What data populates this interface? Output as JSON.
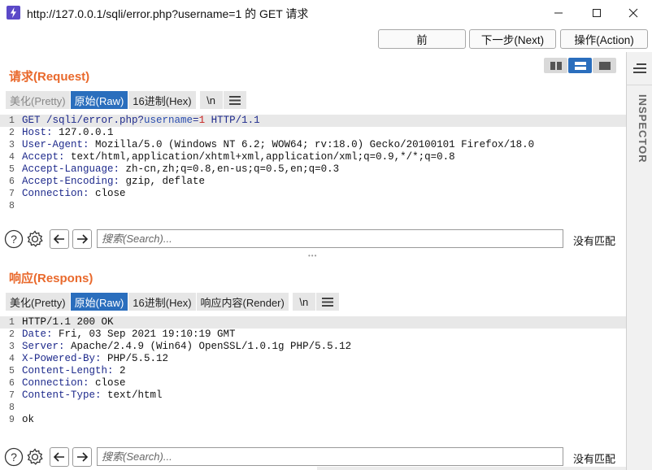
{
  "window": {
    "title": "http://127.0.0.1/sqli/error.php?username=1 的 GET 请求",
    "icon": "burp-lightning-icon"
  },
  "toolbar": {
    "prev_label": "前",
    "next_label": "下一步(Next)",
    "action_label": "操作(Action)"
  },
  "inspector": {
    "label": "INSPECTOR"
  },
  "request": {
    "title": "请求(Request)",
    "tabs": {
      "pretty": "美化(Pretty)",
      "raw": "原始(Raw)",
      "hex": "16进制(Hex)",
      "newline": "\\n"
    },
    "lines": [
      {
        "num": "1",
        "key": "GET /sqli/error.php?",
        "param": "username",
        "eq": "=",
        "val": "1",
        "rest": " HTTP/1.1"
      },
      {
        "num": "2",
        "key": "Host:",
        "val": " 127.0.0.1"
      },
      {
        "num": "3",
        "key": "User-Agent:",
        "val": " Mozilla/5.0 (Windows NT 6.2; WOW64; rv:18.0) Gecko/20100101 Firefox/18.0"
      },
      {
        "num": "4",
        "key": "Accept:",
        "val": " text/html,application/xhtml+xml,application/xml;q=0.9,*/*;q=0.8"
      },
      {
        "num": "5",
        "key": "Accept-Language:",
        "val": " zh-cn,zh;q=0.8,en-us;q=0.5,en;q=0.3"
      },
      {
        "num": "6",
        "key": "Accept-Encoding:",
        "val": " gzip, deflate"
      },
      {
        "num": "7",
        "key": "Connection:",
        "val": " close"
      },
      {
        "num": "8",
        "key": "",
        "val": ""
      }
    ],
    "search": {
      "placeholder": "搜索(Search)...",
      "status": "没有匹配"
    }
  },
  "response": {
    "title": "响应(Respons)",
    "tabs": {
      "pretty": "美化(Pretty)",
      "raw": "原始(Raw)",
      "hex": "16进制(Hex)",
      "render": "响应内容(Render)",
      "newline": "\\n"
    },
    "lines": [
      {
        "num": "1",
        "key": "",
        "val": "HTTP/1.1 200 OK"
      },
      {
        "num": "2",
        "key": "Date:",
        "val": " Fri, 03 Sep 2021 19:10:19 GMT"
      },
      {
        "num": "3",
        "key": "Server:",
        "val": " Apache/2.4.9 (Win64) OpenSSL/1.0.1g PHP/5.5.12"
      },
      {
        "num": "4",
        "key": "X-Powered-By:",
        "val": " PHP/5.5.12"
      },
      {
        "num": "5",
        "key": "Content-Length:",
        "val": " 2"
      },
      {
        "num": "6",
        "key": "Connection:",
        "val": " close"
      },
      {
        "num": "7",
        "key": "Content-Type:",
        "val": " text/html"
      },
      {
        "num": "8",
        "key": "",
        "val": ""
      },
      {
        "num": "9",
        "key": "",
        "val": "ok"
      }
    ],
    "search": {
      "placeholder": "搜索(Search)...",
      "status": "没有匹配"
    }
  },
  "colors": {
    "accent": "#2a6ebd",
    "section_title": "#e9692c",
    "header_key": "#1e2a8c",
    "param_value": "#c8201e"
  }
}
